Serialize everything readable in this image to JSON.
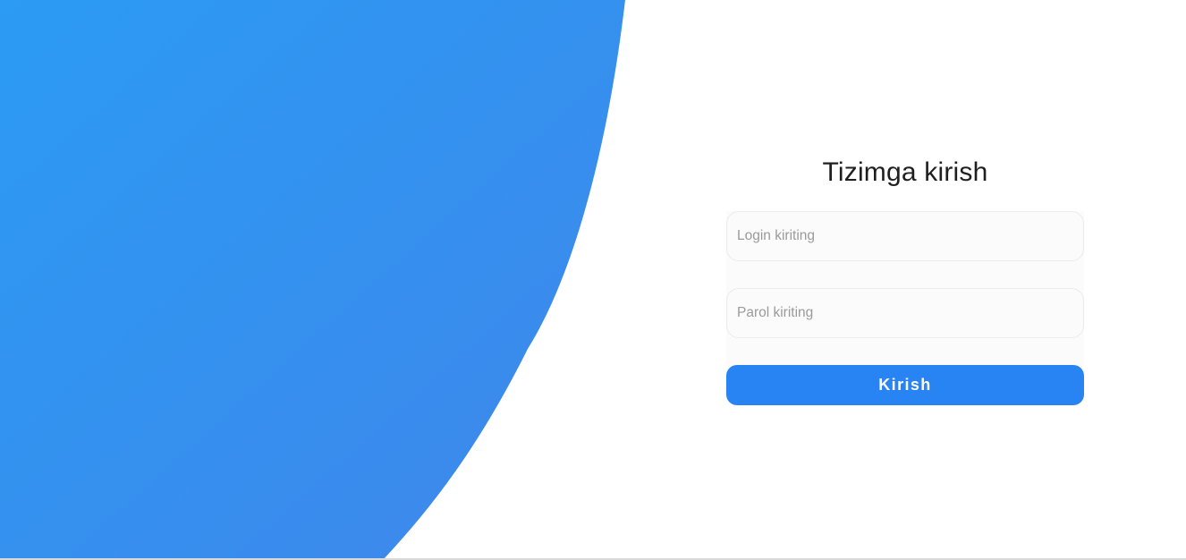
{
  "login": {
    "title": "Tizimga kirish",
    "login_placeholder": "Login kiriting",
    "password_placeholder": "Parol kiriting",
    "submit_label": "Kirish"
  },
  "theme": {
    "gradient_start": "#2b9bf3",
    "gradient_end": "#3f86ea",
    "button_color": "#2884f3"
  }
}
